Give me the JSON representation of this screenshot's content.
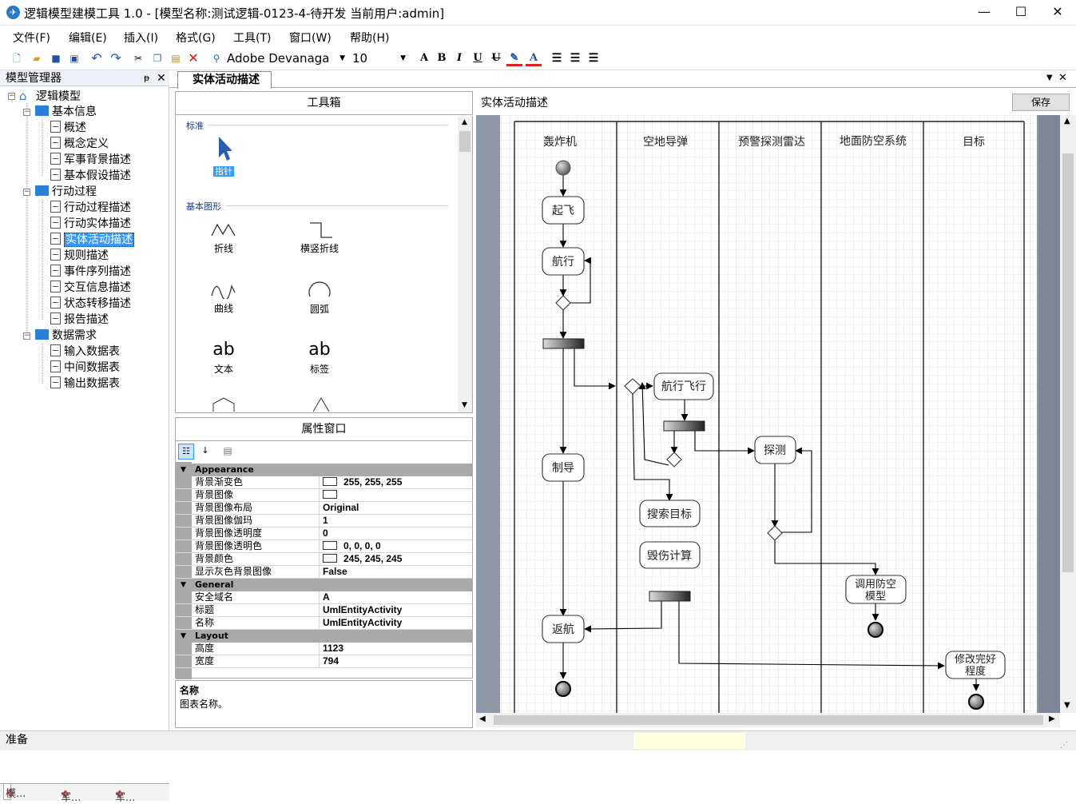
{
  "window": {
    "title": "逻辑模型建模工具 1.0 - [模型名称:测试逻辑-0123-4-待开发 当前用户:admin]"
  },
  "menu": [
    "文件(F)",
    "编辑(E)",
    "插入(I)",
    "格式(G)",
    "工具(T)",
    "窗口(W)",
    "帮助(H)"
  ],
  "toolbar": {
    "font": "Adobe Devanaga",
    "size": "10"
  },
  "model_manager": {
    "title": "模型管理器",
    "root": "逻辑模型",
    "groups": [
      {
        "label": "基本信息",
        "items": [
          "概述",
          "概念定义",
          "军事背景描述",
          "基本假设描述"
        ]
      },
      {
        "label": "行动过程",
        "items": [
          "行动过程描述",
          "行动实体描述",
          "实体活动描述",
          "规则描述",
          "事件序列描述",
          "交互信息描述",
          "状态转移描述",
          "报告描述"
        ]
      },
      {
        "label": "数据需求",
        "items": [
          "输入数据表",
          "中间数据表",
          "输出数据表"
        ]
      }
    ],
    "selected": "实体活动描述",
    "tabs": [
      "模...",
      "军...",
      "军..."
    ]
  },
  "doc_tab": "实体活动描述",
  "toolbox": {
    "title": "工具箱",
    "sections": [
      {
        "label": "标准",
        "tools": [
          "指针"
        ]
      },
      {
        "label": "基本图形",
        "tools": [
          "折线",
          "横竖折线",
          "曲线",
          "圆弧",
          "文本",
          "标签"
        ]
      }
    ],
    "text_glyph": "ab"
  },
  "properties": {
    "title": "属性窗口",
    "categories": [
      {
        "name": "Appearance",
        "rows": [
          {
            "name": "背景渐变色",
            "value": "255, 255, 255",
            "swatch": "#ffffff"
          },
          {
            "name": "背景图像",
            "value": "",
            "swatch": "#ffffff"
          },
          {
            "name": "背景图像布局",
            "value": "Original"
          },
          {
            "name": "背景图像伽玛",
            "value": "1"
          },
          {
            "name": "背景图像透明度",
            "value": "0"
          },
          {
            "name": "背景图像透明色",
            "value": "0, 0, 0, 0",
            "swatch": "#ffffff"
          },
          {
            "name": "背景颜色",
            "value": "245, 245, 245",
            "swatch": "#f5f5f5"
          },
          {
            "name": "显示灰色背景图像",
            "value": "False"
          }
        ]
      },
      {
        "name": "General",
        "rows": [
          {
            "name": "安全域名",
            "value": "A"
          },
          {
            "name": "标题",
            "value": "UmlEntityActivity"
          },
          {
            "name": "名称",
            "value": "UmlEntityActivity"
          }
        ]
      },
      {
        "name": "Layout",
        "rows": [
          {
            "name": "高度",
            "value": "1123"
          },
          {
            "name": "宽度",
            "value": "794"
          }
        ]
      }
    ],
    "desc_title": "名称",
    "desc_text": "图表名称。"
  },
  "canvas": {
    "title": "实体活动描述",
    "save": "保存",
    "lanes": [
      "轰炸机",
      "空地导弹",
      "预警探测雷达",
      "地面防空系统",
      "目标"
    ],
    "activities": [
      "起飞",
      "航行",
      "制导",
      "返航",
      "航行飞行",
      "探测",
      "搜索目标",
      "毁伤计算",
      "调用防空模型",
      "修改完好程度"
    ]
  },
  "status": "准备"
}
